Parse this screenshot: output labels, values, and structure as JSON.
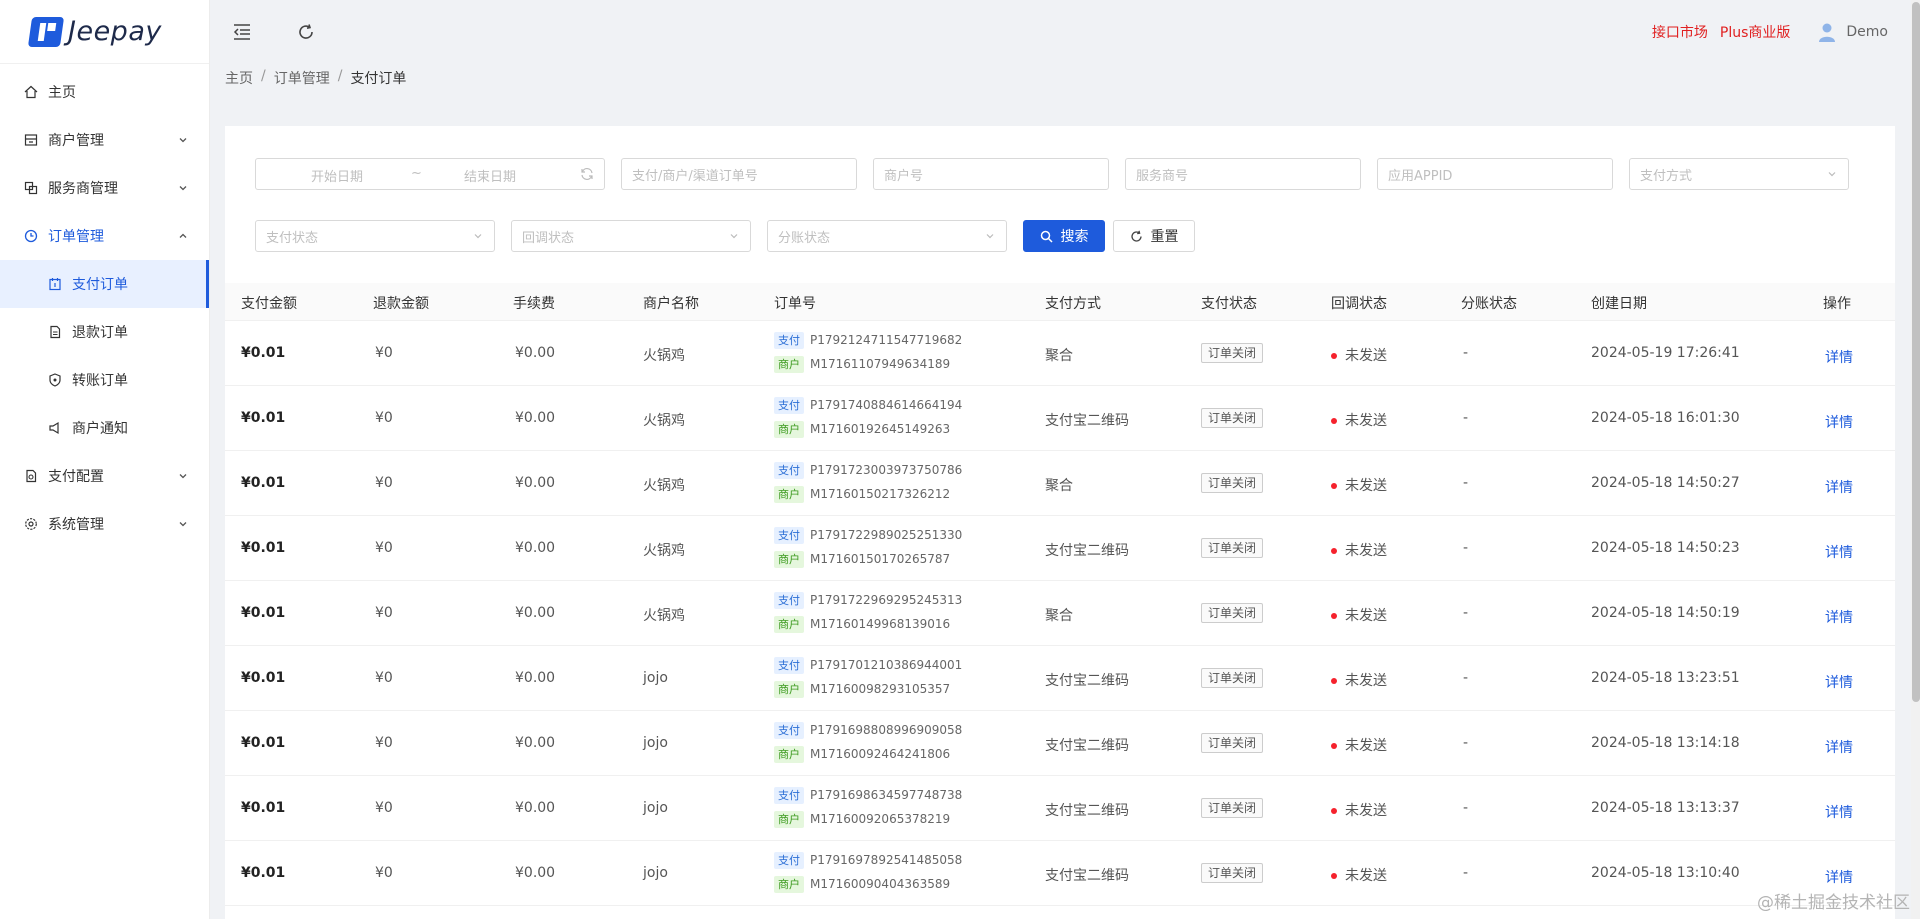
{
  "app": {
    "name": "Jeepay",
    "brand_color": "#1e5bdc"
  },
  "sidebar": {
    "items": [
      {
        "label": "主页",
        "icon": "home-icon"
      },
      {
        "label": "商户管理",
        "icon": "store-icon"
      },
      {
        "label": "服务商管理",
        "icon": "copy-icon"
      },
      {
        "label": "订单管理",
        "icon": "order-icon"
      },
      {
        "label": "支付订单",
        "icon": "calendar-icon"
      },
      {
        "label": "退款订单",
        "icon": "file-icon"
      },
      {
        "label": "转账订单",
        "icon": "shield-icon"
      },
      {
        "label": "商户通知",
        "icon": "bell-icon"
      },
      {
        "label": "支付配置",
        "icon": "config-icon"
      },
      {
        "label": "系统管理",
        "icon": "gear-icon"
      }
    ]
  },
  "header": {
    "links": [
      "接口市场",
      "Plus商业版"
    ],
    "user": "Demo"
  },
  "breadcrumb": [
    "主页",
    "订单管理",
    "支付订单"
  ],
  "filters": {
    "start_date": "开始日期",
    "range_sep": "~",
    "end_date": "结束日期",
    "order_no": "支付/商户/渠道订单号",
    "mch_no": "商户号",
    "isv_no": "服务商号",
    "app_id": "应用APPID",
    "way_code": "支付方式",
    "pay_state": "支付状态",
    "notify_state": "回调状态",
    "division_state": "分账状态",
    "search": "搜索",
    "reset": "重置"
  },
  "table": {
    "columns": [
      "支付金额",
      "退款金额",
      "手续费",
      "商户名称",
      "订单号",
      "支付方式",
      "支付状态",
      "回调状态",
      "分账状态",
      "创建日期",
      "操作"
    ],
    "rows": [
      {
        "amount": "¥0.01",
        "refund": "¥0",
        "fee": "¥0.00",
        "mch": "火锅鸡",
        "pay_tag": "支付",
        "pay_no": "P1792124711547719682",
        "mch_tag": "商户",
        "mch_no": "M17161107949634189",
        "way": "聚合",
        "state": "订单关闭",
        "notify": "未发送",
        "division": "-",
        "created": "2024-05-19 17:26:41",
        "action": "详情"
      },
      {
        "amount": "¥0.01",
        "refund": "¥0",
        "fee": "¥0.00",
        "mch": "火锅鸡",
        "pay_tag": "支付",
        "pay_no": "P1791740884614664194",
        "mch_tag": "商户",
        "mch_no": "M17160192645149263",
        "way": "支付宝二维码",
        "state": "订单关闭",
        "notify": "未发送",
        "division": "-",
        "created": "2024-05-18 16:01:30",
        "action": "详情"
      },
      {
        "amount": "¥0.01",
        "refund": "¥0",
        "fee": "¥0.00",
        "mch": "火锅鸡",
        "pay_tag": "支付",
        "pay_no": "P1791723003973750786",
        "mch_tag": "商户",
        "mch_no": "M17160150217326212",
        "way": "聚合",
        "state": "订单关闭",
        "notify": "未发送",
        "division": "-",
        "created": "2024-05-18 14:50:27",
        "action": "详情"
      },
      {
        "amount": "¥0.01",
        "refund": "¥0",
        "fee": "¥0.00",
        "mch": "火锅鸡",
        "pay_tag": "支付",
        "pay_no": "P1791722989025251330",
        "mch_tag": "商户",
        "mch_no": "M17160150170265787",
        "way": "支付宝二维码",
        "state": "订单关闭",
        "notify": "未发送",
        "division": "-",
        "created": "2024-05-18 14:50:23",
        "action": "详情"
      },
      {
        "amount": "¥0.01",
        "refund": "¥0",
        "fee": "¥0.00",
        "mch": "火锅鸡",
        "pay_tag": "支付",
        "pay_no": "P1791722969295245313",
        "mch_tag": "商户",
        "mch_no": "M17160149968139016",
        "way": "聚合",
        "state": "订单关闭",
        "notify": "未发送",
        "division": "-",
        "created": "2024-05-18 14:50:19",
        "action": "详情"
      },
      {
        "amount": "¥0.01",
        "refund": "¥0",
        "fee": "¥0.00",
        "mch": "jojo",
        "pay_tag": "支付",
        "pay_no": "P1791701210386944001",
        "mch_tag": "商户",
        "mch_no": "M17160098293105357",
        "way": "支付宝二维码",
        "state": "订单关闭",
        "notify": "未发送",
        "division": "-",
        "created": "2024-05-18 13:23:51",
        "action": "详情"
      },
      {
        "amount": "¥0.01",
        "refund": "¥0",
        "fee": "¥0.00",
        "mch": "jojo",
        "pay_tag": "支付",
        "pay_no": "P1791698808996909058",
        "mch_tag": "商户",
        "mch_no": "M17160092464241806",
        "way": "支付宝二维码",
        "state": "订单关闭",
        "notify": "未发送",
        "division": "-",
        "created": "2024-05-18 13:14:18",
        "action": "详情"
      },
      {
        "amount": "¥0.01",
        "refund": "¥0",
        "fee": "¥0.00",
        "mch": "jojo",
        "pay_tag": "支付",
        "pay_no": "P1791698634597748738",
        "mch_tag": "商户",
        "mch_no": "M17160092065378219",
        "way": "支付宝二维码",
        "state": "订单关闭",
        "notify": "未发送",
        "division": "-",
        "created": "2024-05-18 13:13:37",
        "action": "详情"
      },
      {
        "amount": "¥0.01",
        "refund": "¥0",
        "fee": "¥0.00",
        "mch": "jojo",
        "pay_tag": "支付",
        "pay_no": "P1791697892541485058",
        "mch_tag": "商户",
        "mch_no": "M17160090404363589",
        "way": "支付宝二维码",
        "state": "订单关闭",
        "notify": "未发送",
        "division": "-",
        "created": "2024-05-18 13:10:40",
        "action": "详情"
      }
    ]
  },
  "watermark": "@稀土掘金技术社区"
}
